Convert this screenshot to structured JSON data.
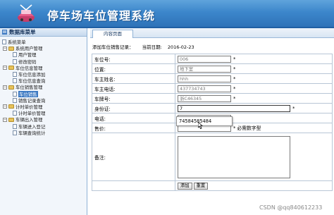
{
  "header": {
    "app_title": "停车场车位管理系统"
  },
  "sidebar": {
    "title": "数据库菜单",
    "tree": [
      {
        "label": "系统菜单",
        "level": 0,
        "type": "page"
      },
      {
        "label": "系统用户管理",
        "level": 1,
        "type": "folder",
        "expanded": true
      },
      {
        "label": "用户管理",
        "level": 2,
        "type": "page"
      },
      {
        "label": "修改密码",
        "level": 2,
        "type": "page"
      },
      {
        "label": "车位信息管理",
        "level": 1,
        "type": "folder",
        "expanded": true
      },
      {
        "label": "车位信息添加",
        "level": 2,
        "type": "page"
      },
      {
        "label": "车位信息查询",
        "level": 2,
        "type": "page"
      },
      {
        "label": "车位销售管理",
        "level": 1,
        "type": "folder",
        "expanded": true
      },
      {
        "label": "车位销售",
        "level": 2,
        "type": "page",
        "selected": true
      },
      {
        "label": "销售记录查询",
        "level": 2,
        "type": "page"
      },
      {
        "label": "计时单价管理",
        "level": 1,
        "type": "folder",
        "expanded": true
      },
      {
        "label": "计时单价管理",
        "level": 2,
        "type": "page"
      },
      {
        "label": "车辆出入管理",
        "level": 1,
        "type": "folder",
        "expanded": true
      },
      {
        "label": "车辆进入登记",
        "level": 2,
        "type": "page"
      },
      {
        "label": "车辆查询统计",
        "level": 2,
        "type": "page"
      }
    ]
  },
  "tabs": {
    "active": "内容页面"
  },
  "content": {
    "caption": "添加车位销售记录：",
    "date_label": "当前日期:",
    "date_value": "2016-02-23",
    "rows": {
      "space_no": {
        "label": "车位号:",
        "value": "006",
        "required": "*"
      },
      "location": {
        "label": "位置:",
        "value": "地下室",
        "required": "*"
      },
      "owner_name": {
        "label": "车主姓名:",
        "value": "hhh",
        "required": "*"
      },
      "owner_phone": {
        "label": "车主电话:",
        "value": "437734743",
        "required": "*"
      },
      "plate": {
        "label": "车牌号:",
        "value": "浙C46345",
        "required": "*"
      },
      "id_card": {
        "label": "身份证:",
        "value": "7",
        "required": "*"
      },
      "phone": {
        "label": "电话:",
        "value": "",
        "required": ""
      },
      "price": {
        "label": "售价:",
        "value": "",
        "required": "*",
        "hint": "必需数字型"
      },
      "remark": {
        "label": "备注:"
      }
    },
    "buttons": {
      "add": "添加",
      "reset": "重置"
    },
    "autocomplete": {
      "suggestion": "74584585484"
    }
  },
  "watermark": "CSDN @qq840612233",
  "colors": {
    "header": "#3c86cb",
    "sidebar_bg": "#f2f6fb",
    "selected": "#3b78c2"
  }
}
